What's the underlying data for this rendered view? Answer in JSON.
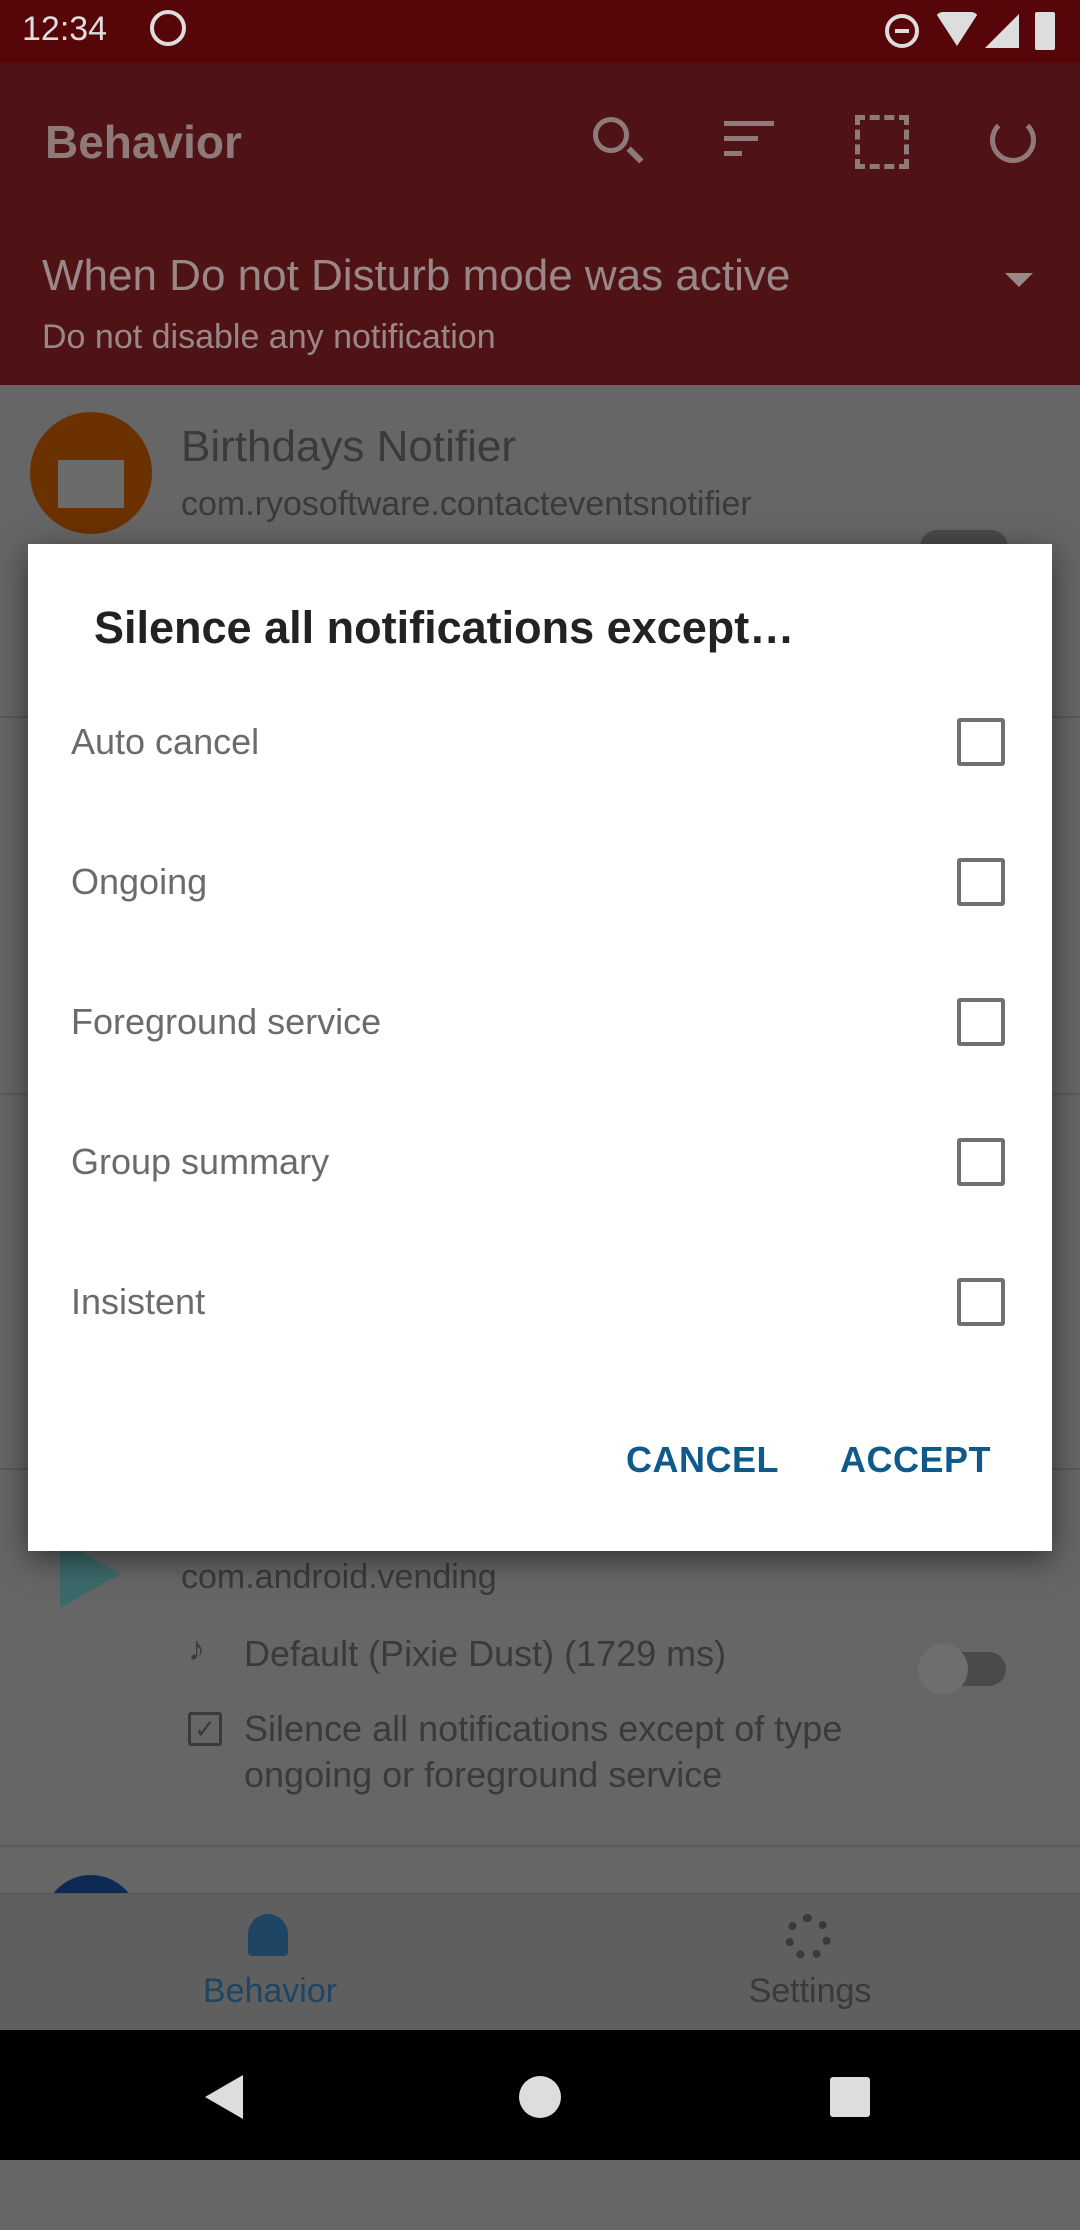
{
  "status_bar": {
    "time": "12:34"
  },
  "app_bar": {
    "title": "Behavior",
    "icons": [
      "search-icon",
      "sort-icon",
      "select-all-icon",
      "refresh-icon"
    ],
    "spinner": {
      "title": "When Do not Disturb mode was active",
      "subtitle": "Do not disable any notification"
    }
  },
  "list": {
    "item1": {
      "name": "Birthdays Notifier",
      "package": "com.ryosoftware.contacteventsnotifier"
    },
    "item2": {
      "package": "com.android.vending",
      "sound": "Default (Pixie Dust) (1729 ms)",
      "rule": "Silence all notifications except of type ongoing or foreground service"
    }
  },
  "dialog": {
    "title": "Silence all notifications except…",
    "options": [
      {
        "label": "Auto cancel",
        "checked": false
      },
      {
        "label": "Ongoing",
        "checked": false
      },
      {
        "label": "Foreground service",
        "checked": false
      },
      {
        "label": "Group summary",
        "checked": false
      },
      {
        "label": "Insistent",
        "checked": false
      }
    ],
    "cancel": "CANCEL",
    "accept": "ACCEPT",
    "accent": "#0f5a8a"
  },
  "bottom_nav": {
    "items": [
      {
        "label": "Behavior",
        "active": true
      },
      {
        "label": "Settings",
        "active": false
      }
    ]
  }
}
